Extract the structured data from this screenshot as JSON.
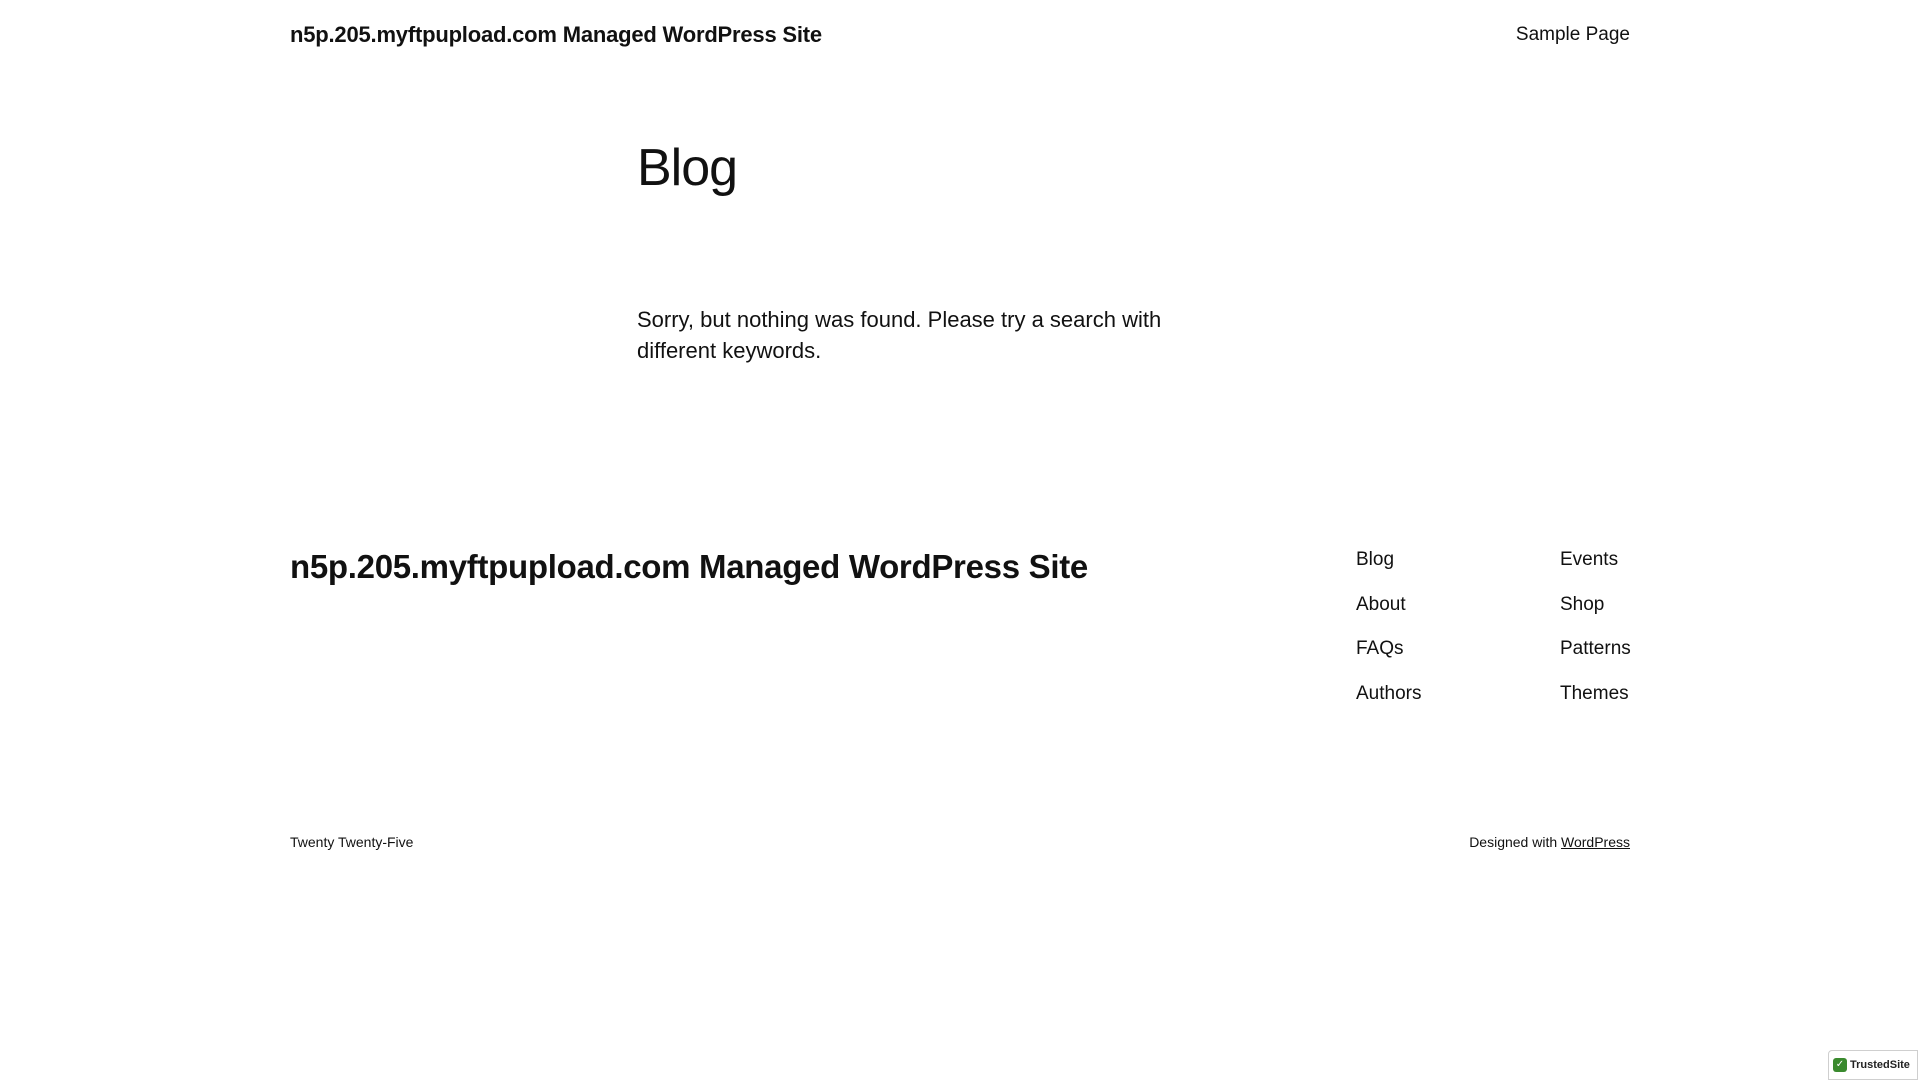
{
  "header": {
    "site_title": "n5p.205.myftpupload.com Managed WordPress Site",
    "nav": [
      {
        "label": "Sample Page"
      }
    ]
  },
  "main": {
    "heading": "Blog",
    "message": "Sorry, but nothing was found. Please try a search with different keywords."
  },
  "footer": {
    "site_title": "n5p.205.myftpupload.com Managed WordPress Site",
    "nav_col_1": [
      {
        "label": "Blog"
      },
      {
        "label": "About"
      },
      {
        "label": "FAQs"
      },
      {
        "label": "Authors"
      }
    ],
    "nav_col_2": [
      {
        "label": "Events"
      },
      {
        "label": "Shop"
      },
      {
        "label": "Patterns"
      },
      {
        "label": "Themes"
      }
    ],
    "theme_name": "Twenty Twenty-Five",
    "credit_prefix": "Designed with",
    "credit_link": "WordPress"
  },
  "badge": {
    "label": "TrustedSite",
    "icon": "check-icon",
    "color": "#3a8a2e"
  }
}
